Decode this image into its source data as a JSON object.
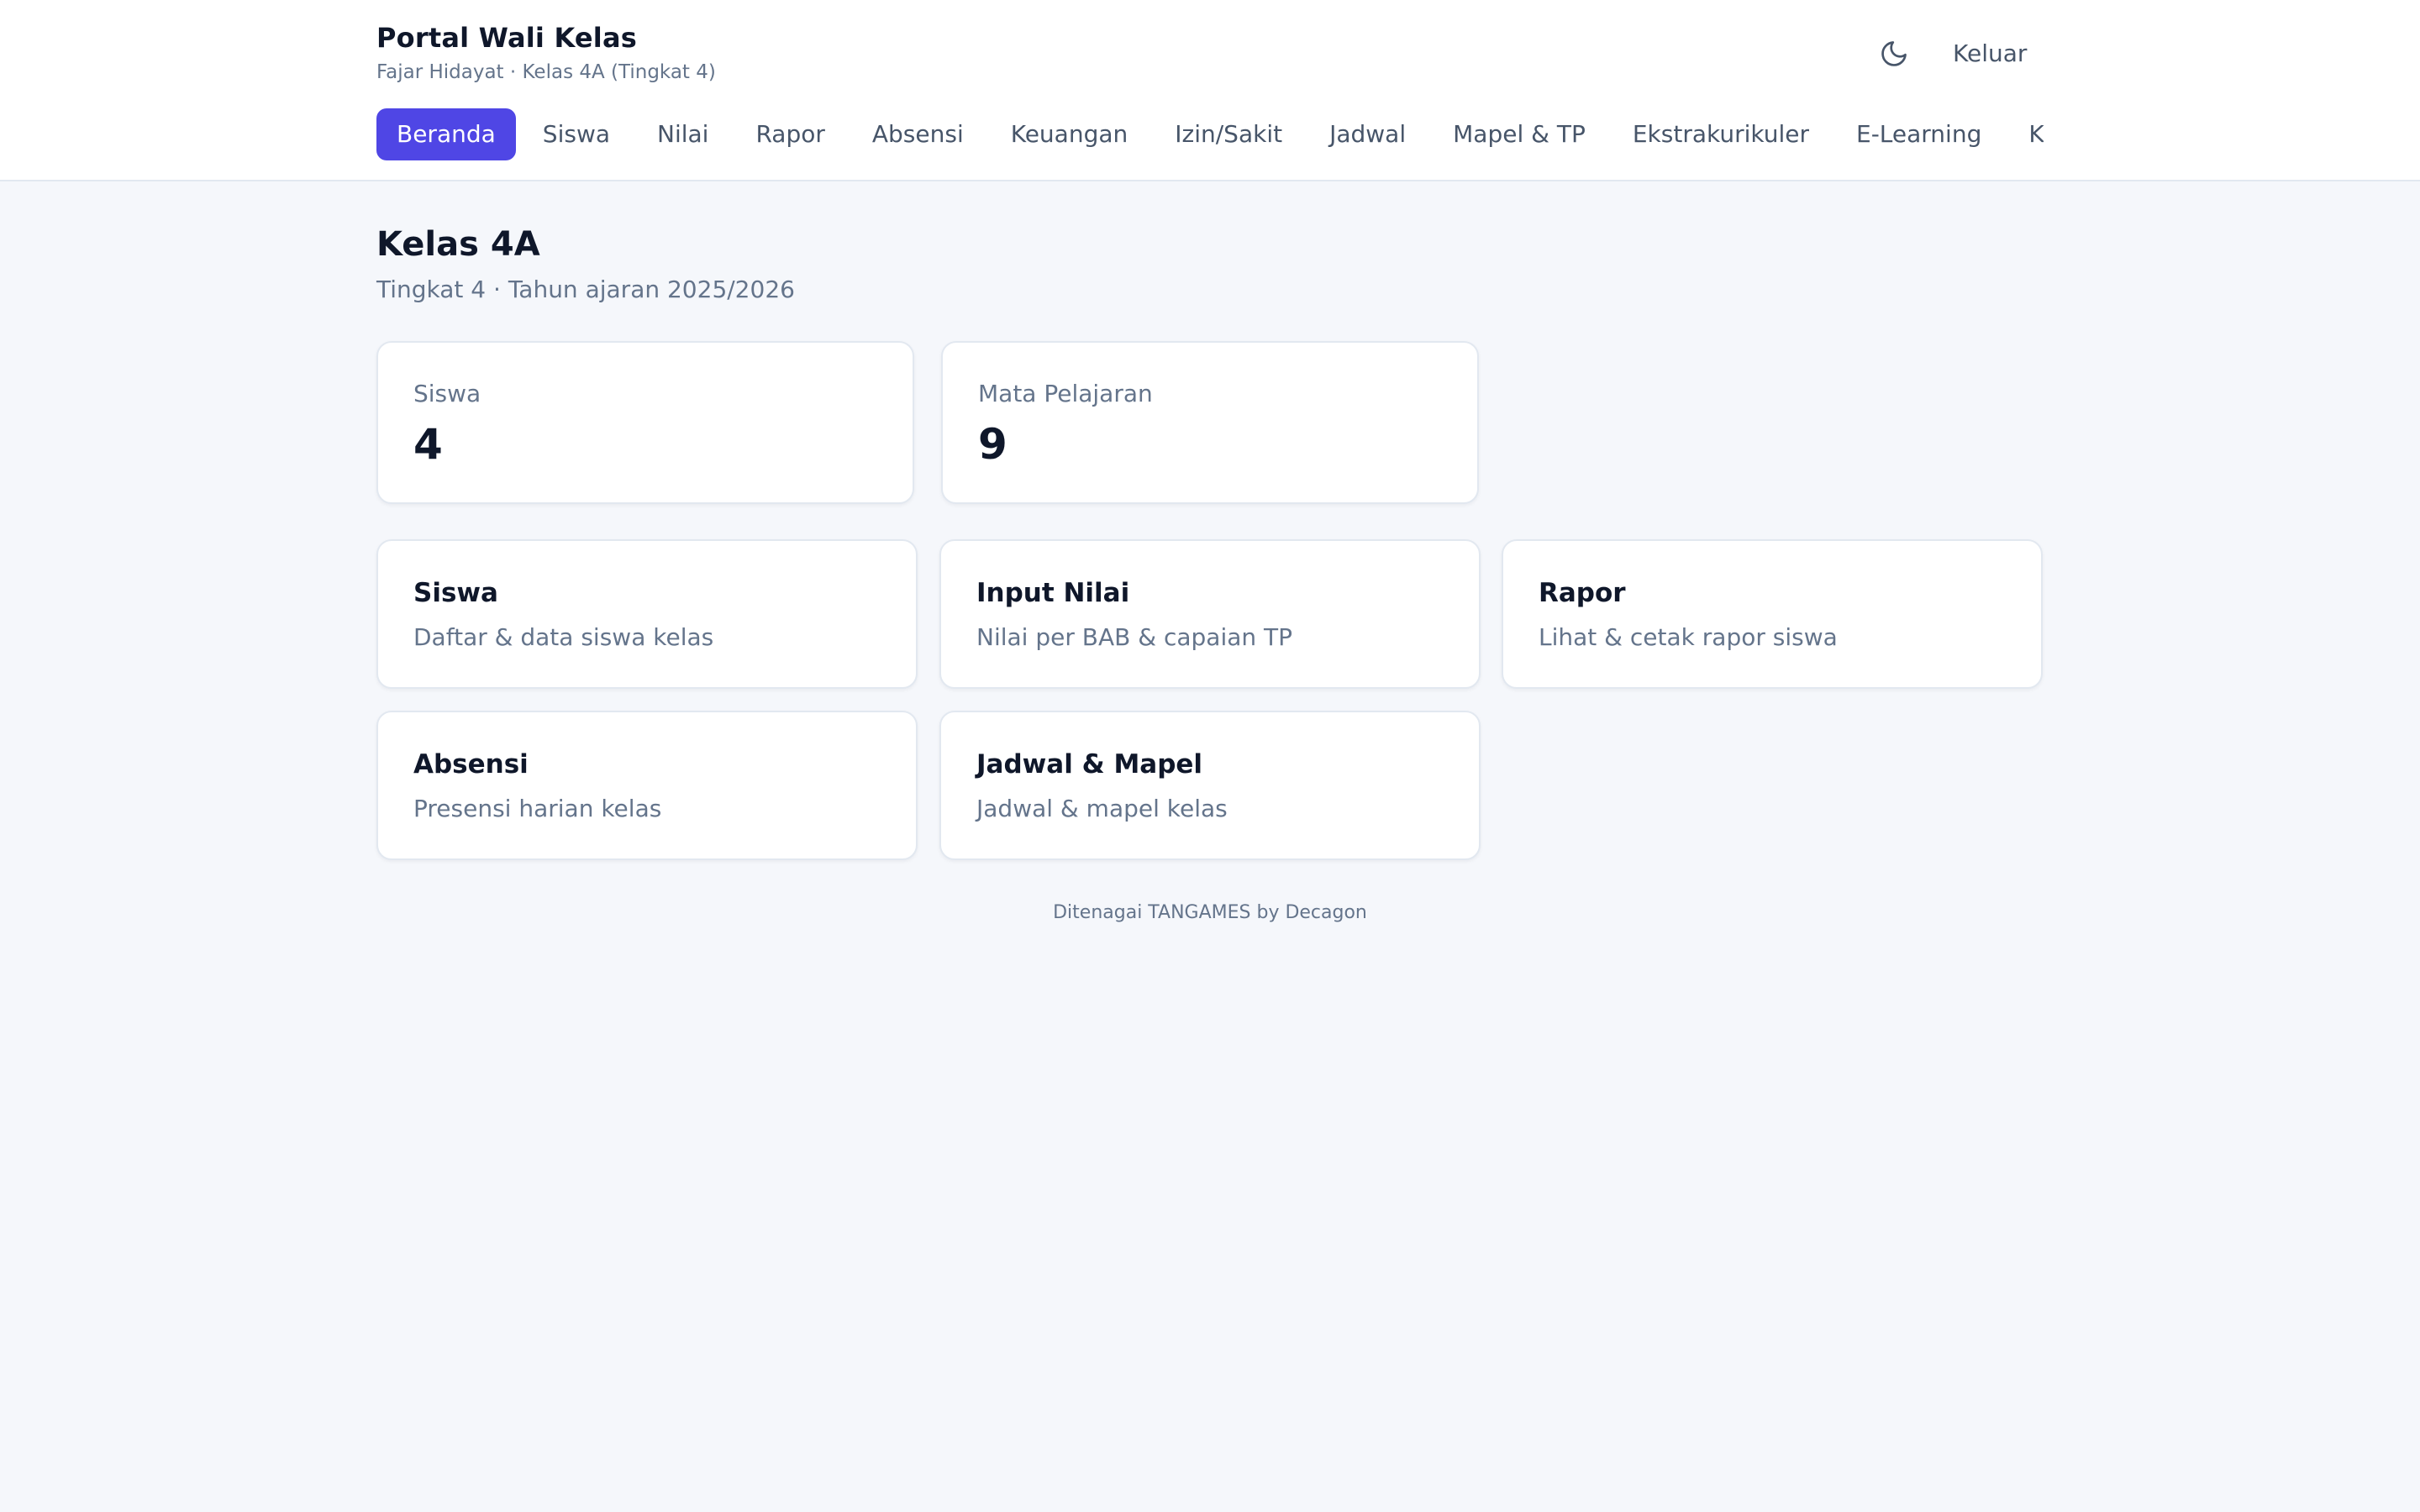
{
  "header": {
    "title": "Portal Wali Kelas",
    "subtitle": "Fajar Hidayat · Kelas 4A (Tingkat 4)",
    "theme_icon": "moon-icon",
    "logout_label": "Keluar"
  },
  "nav": {
    "tabs": [
      {
        "label": "Beranda",
        "active": true
      },
      {
        "label": "Siswa"
      },
      {
        "label": "Nilai"
      },
      {
        "label": "Rapor"
      },
      {
        "label": "Absensi"
      },
      {
        "label": "Keuangan"
      },
      {
        "label": "Izin/Sakit"
      },
      {
        "label": "Jadwal"
      },
      {
        "label": "Mapel & TP"
      },
      {
        "label": "Ekstrakurikuler"
      },
      {
        "label": "E-Learning"
      },
      {
        "label": "Kuis"
      }
    ]
  },
  "main": {
    "title": "Kelas 4A",
    "subtitle": "Tingkat 4 · Tahun ajaran 2025/2026",
    "stats": [
      {
        "label": "Siswa",
        "value": "4"
      },
      {
        "label": "Mata Pelajaran",
        "value": "9"
      }
    ],
    "links": [
      {
        "title": "Siswa",
        "desc": "Daftar & data siswa kelas"
      },
      {
        "title": "Input Nilai",
        "desc": "Nilai per BAB & capaian TP"
      },
      {
        "title": "Rapor",
        "desc": "Lihat & cetak rapor siswa"
      },
      {
        "title": "Absensi",
        "desc": "Presensi harian kelas"
      },
      {
        "title": "Jadwal & Mapel",
        "desc": "Jadwal & mapel kelas"
      }
    ]
  },
  "footer": {
    "text": "Ditenagai TANGAMES by Decagon"
  },
  "colors": {
    "accent": "#4f46e5",
    "background": "#f5f7fb",
    "text_primary": "#0f172a",
    "text_muted": "#64748b"
  }
}
